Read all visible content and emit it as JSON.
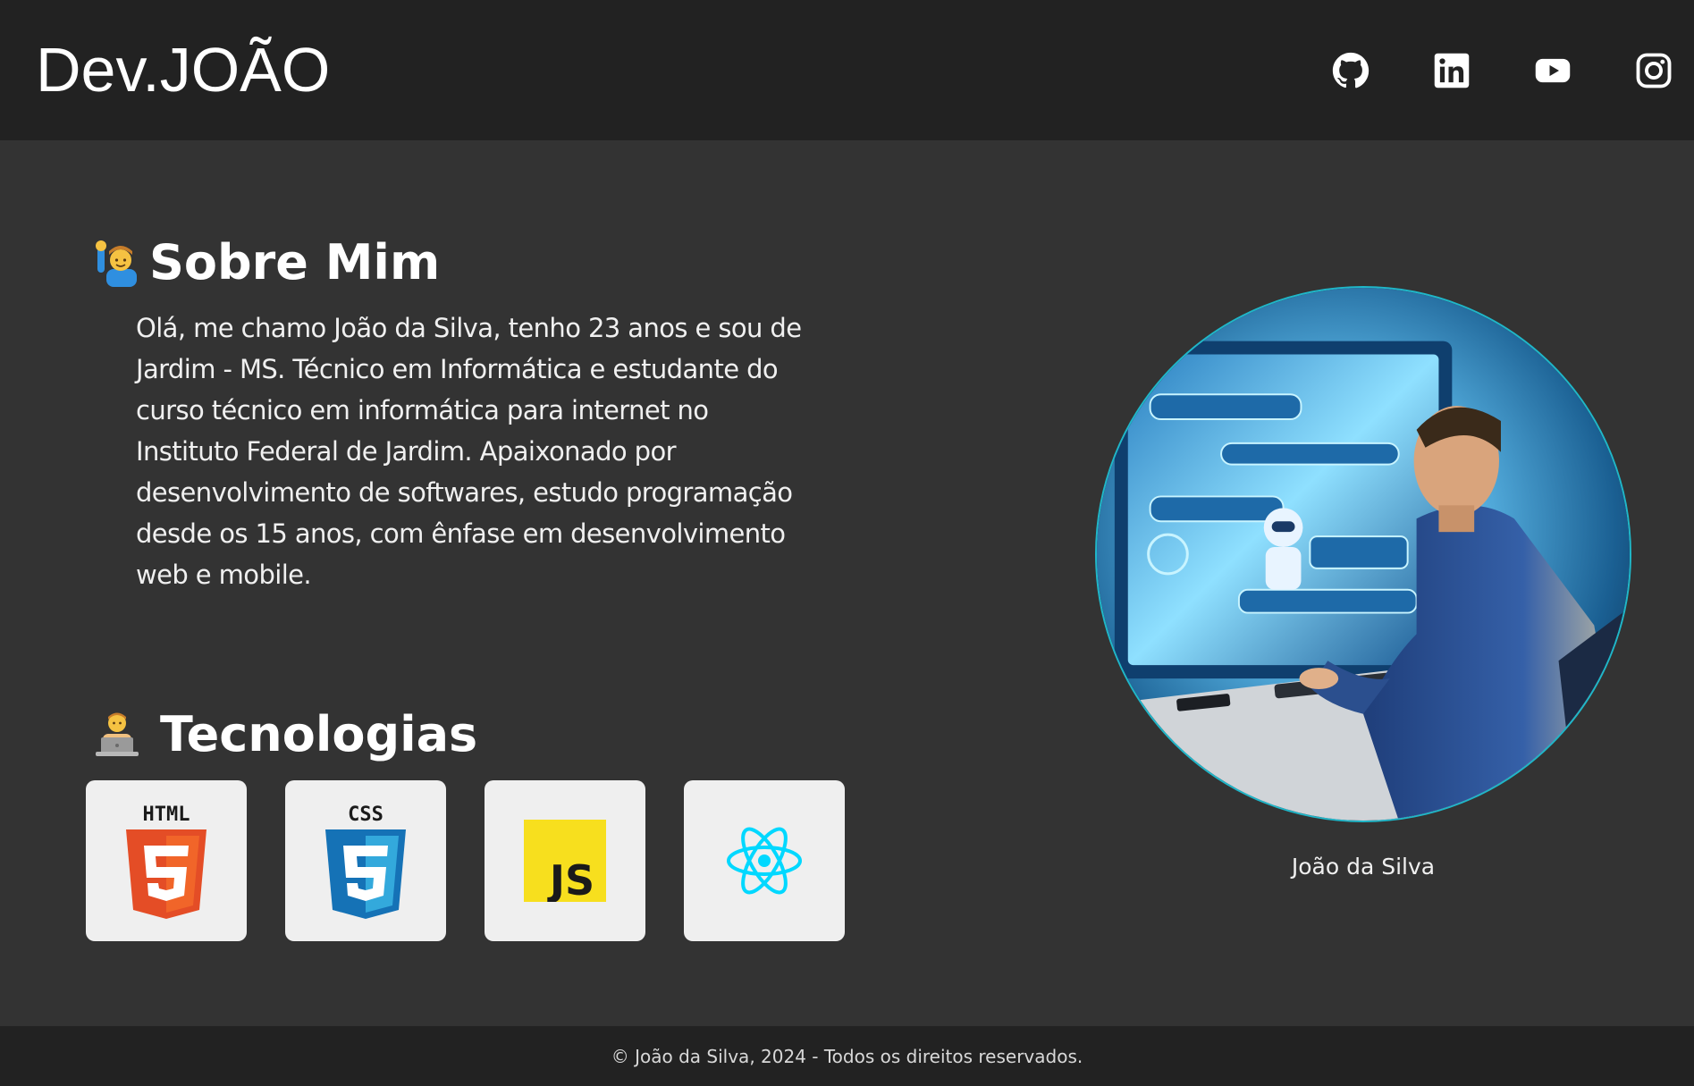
{
  "header": {
    "logo": "Dev.JOÃO",
    "social": [
      {
        "name": "github-icon"
      },
      {
        "name": "linkedin-icon"
      },
      {
        "name": "youtube-icon"
      },
      {
        "name": "instagram-icon"
      }
    ]
  },
  "about": {
    "emoji": "person-raising-hand-icon",
    "title": "Sobre Mim",
    "text": "Olá, me chamo João da Silva, tenho 23 anos e sou de Jardim - MS. Técnico em Informática e estudante do curso técnico em informática para internet no Instituto Federal de Jardim. Apaixonado por desenvolvimento de softwares, estudo programação desde os 15 anos, com ênfase em desenvolvimento web e mobile."
  },
  "technologies": {
    "emoji": "technologist-icon",
    "title": "Tecnologias",
    "items": [
      {
        "name": "html5-icon",
        "label": "HTML"
      },
      {
        "name": "css3-icon",
        "label": "CSS"
      },
      {
        "name": "javascript-icon",
        "label": "JS"
      },
      {
        "name": "react-icon"
      }
    ]
  },
  "profile": {
    "caption": "João da Silva"
  },
  "footer": {
    "text": "© João da Silva, 2024 - Todos os direitos reservados."
  },
  "colors": {
    "header_bg": "#222222",
    "body_bg": "#333333",
    "card_bg": "#efefef",
    "accent": "#1fb7c9"
  }
}
